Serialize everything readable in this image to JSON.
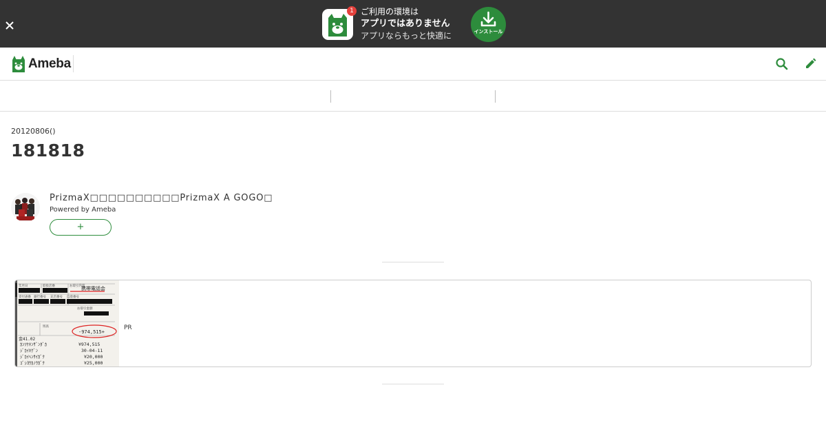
{
  "banner": {
    "badge_count": "1",
    "line1": "ご利用の環境は",
    "line2": "アプリではありません",
    "line3": "アプリならもっと快適に",
    "install_label": "インストール",
    "close_icon": "close-icon",
    "accent_color": "#2d8c3c",
    "background_color": "#333333"
  },
  "header": {
    "logo_text": "Ameba",
    "search_icon": "search-icon",
    "edit_icon": "pencil-icon"
  },
  "entry": {
    "date": "20120806()",
    "title": "181818"
  },
  "blog": {
    "name": "PrizmaX□□□□□□□□□□PrizmaX A GOGO□",
    "powered_by": "Powered by Ameba",
    "follow_label": "+"
  },
  "pr": {
    "label": "PR",
    "image": {
      "header_labels": [
        "年月日",
        "取扱店番",
        "お取引内容",
        "受付通番",
        "銀行番号",
        "支店番号",
        "口座番号",
        "お取引金額",
        "残高"
      ],
      "company": "携帯電話会",
      "highlight_value": "-974,515+",
      "rows": [
        {
          "label": "ｶﾝﾂｹｷﾝｻﾞﾝﾀﾞｶ",
          "value": "¥974,515"
        },
        {
          "label": "ｼﾞｶｲｷｹﾞﾝ",
          "value": "30-04-11"
        },
        {
          "label": "ｼﾞｶｲﾍﾝｻｲｶﾞｸ",
          "value": "¥20,000"
        },
        {
          "label": "ｺﾞｼﾖｳｶﾉｳｶﾞｸ",
          "value": "¥25,000"
        }
      ],
      "row_header": "金41.02"
    }
  }
}
